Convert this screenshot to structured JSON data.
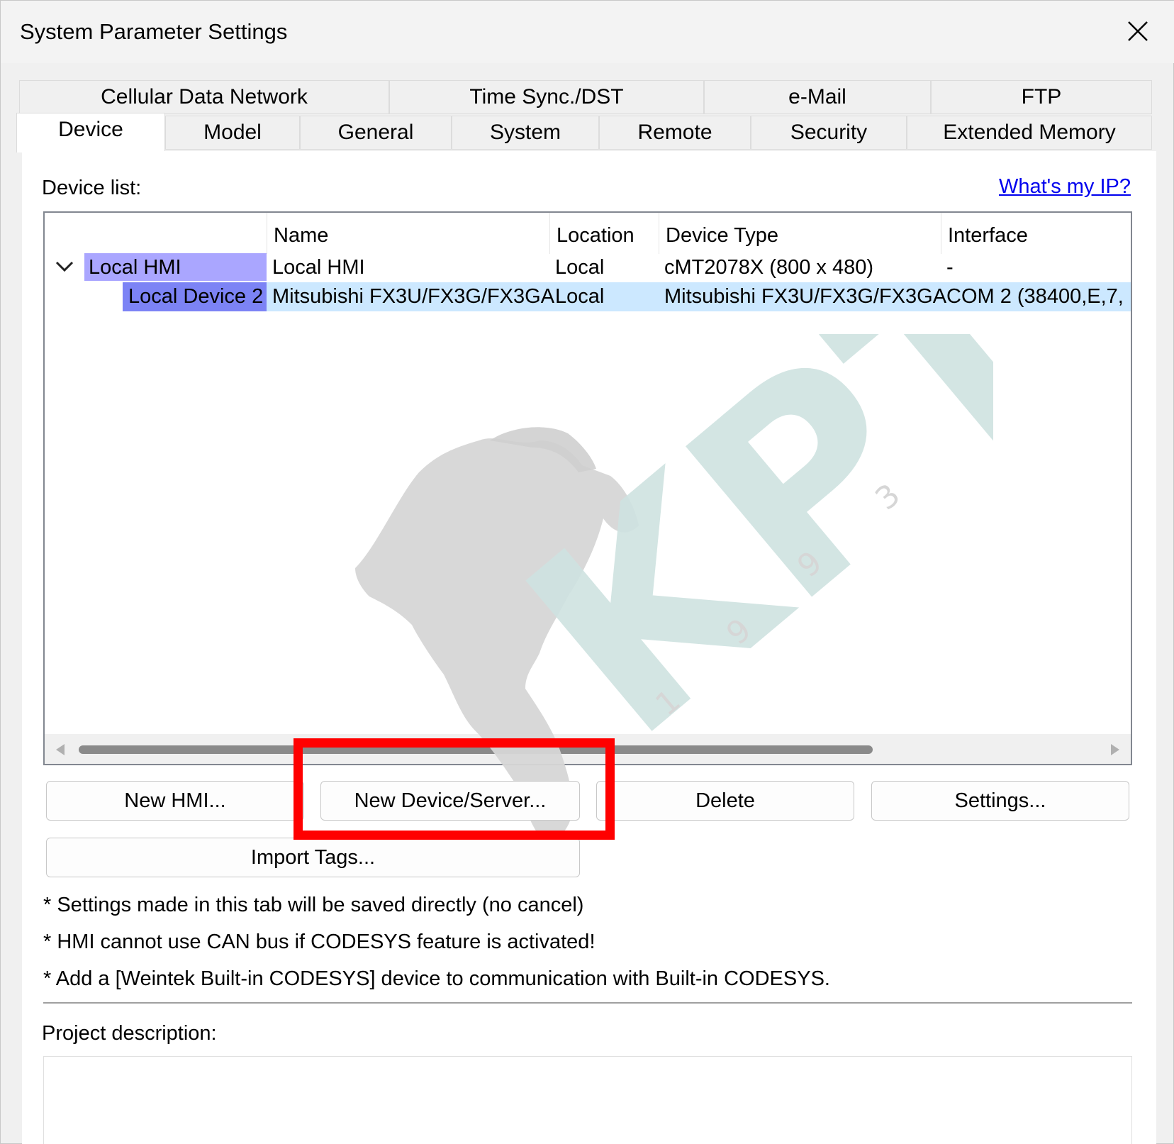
{
  "window": {
    "title": "System Parameter Settings",
    "close_icon": "close-icon"
  },
  "tabs": {
    "row1": [
      "Cellular Data Network",
      "Time Sync./DST",
      "e-Mail",
      "FTP"
    ],
    "row2": [
      "Device",
      "Model",
      "General",
      "System",
      "Remote",
      "Security",
      "Extended Memory"
    ],
    "active": "Device"
  },
  "device_tab": {
    "device_list_label": "Device list:",
    "whats_my_ip_link": "What's my IP?",
    "columns": [
      "Name",
      "Location",
      "Device Type",
      "Interface"
    ],
    "rows": [
      {
        "tree": "Local HMI",
        "name": "Local HMI",
        "location": "Local",
        "device_type": "cMT2078X (800 x 480)",
        "interface": "-"
      },
      {
        "tree": "Local Device 2",
        "name": "Mitsubishi FX3U/FX3G/FX3GA",
        "location": "Local",
        "device_type": "Mitsubishi FX3U/FX3G/FX3GA",
        "interface": "COM 2 (38400,E,7,"
      }
    ],
    "buttons": {
      "new_hmi": "New HMI...",
      "new_device_server": "New Device/Server...",
      "delete": "Delete",
      "settings": "Settings...",
      "import_tags": "Import Tags..."
    },
    "notes": [
      "* Settings made in this tab will be saved directly (no cancel)",
      "* HMI cannot use CAN bus if CODESYS feature is activated!",
      "* Add a [Weintek Built-in CODESYS] device to communication with Built-in CODESYS."
    ],
    "project_description_label": "Project description:"
  },
  "watermark": {
    "text": "KPT",
    "digits": [
      "1",
      "9",
      "9",
      "3"
    ]
  },
  "colors": {
    "tree_local_hmi_bg": "#aaa6ff",
    "tree_local_device_bg": "#7c83f5",
    "selected_row_bg": "#cce8ff",
    "highlight_box": "#ff0000",
    "link": "#0000ee",
    "watermark_teal": "#cfe3e1",
    "watermark_gray": "#d6d6d6"
  }
}
